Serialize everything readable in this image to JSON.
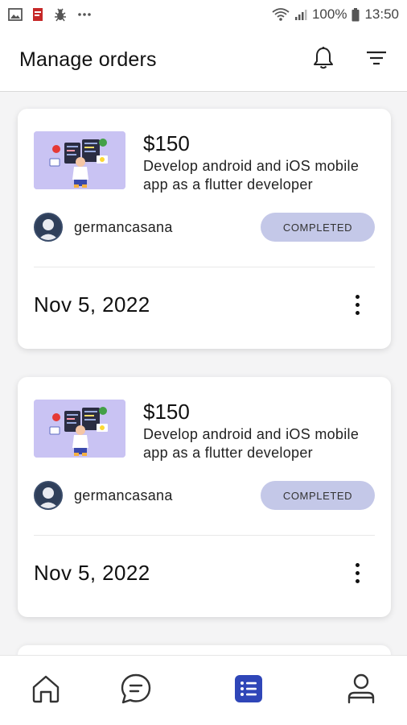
{
  "status_bar": {
    "battery": "100%",
    "time": "13:50",
    "icons": [
      "image-icon",
      "pdf-icon",
      "bug-icon",
      "more-notifications-icon",
      "wifi-icon",
      "signal-icon",
      "battery-icon"
    ]
  },
  "header": {
    "title": "Manage orders",
    "icons": [
      "bell-icon",
      "filter-icon"
    ]
  },
  "orders": [
    {
      "price": "$150",
      "description_line1": "Develop android and iOS mobile",
      "description_line2": "app as a flutter developer",
      "seller": "germancasana",
      "status": "COMPLETED",
      "date": "Nov 5, 2022"
    },
    {
      "price": "$150",
      "description_line1": "Develop android and iOS mobile",
      "description_line2": "app as a flutter developer",
      "seller": "germancasana",
      "status": "COMPLETED",
      "date": "Nov 5, 2022"
    }
  ],
  "bottom_nav": {
    "items": [
      "home-icon",
      "chat-icon",
      "orders-list-icon",
      "profile-icon"
    ],
    "active": "orders-list-icon"
  },
  "colors": {
    "accent": "#2f46b8",
    "badge_bg": "#c4c8e8",
    "thumb_bg": "#c9c3f3"
  }
}
